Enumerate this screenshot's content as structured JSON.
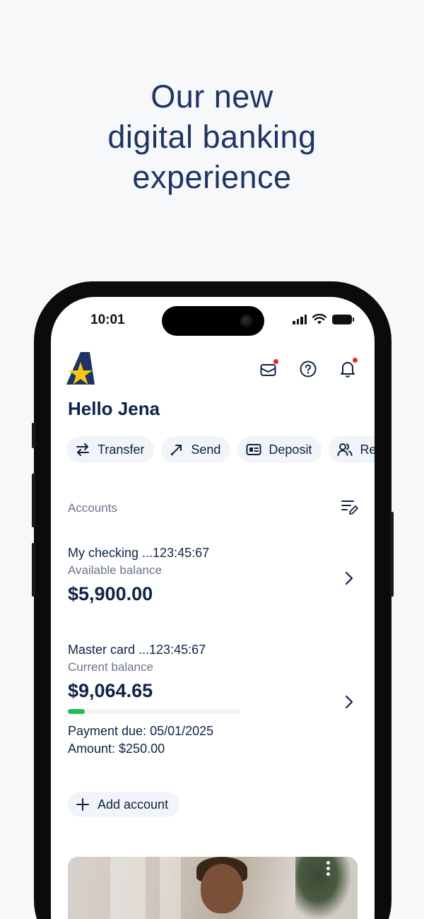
{
  "headline": {
    "line1": "Our new",
    "line2": "digital banking",
    "line3": "experience"
  },
  "status_bar": {
    "time": "10:01"
  },
  "app": {
    "logo_icon": "star-a-logo",
    "header_icons": [
      "mail-icon",
      "help-icon",
      "bell-icon"
    ],
    "greeting": "Hello Jena",
    "quick_actions": [
      {
        "label": "Transfer",
        "icon": "transfer-arrows-icon"
      },
      {
        "label": "Send",
        "icon": "send-arrow-icon"
      },
      {
        "label": "Deposit",
        "icon": "check-deposit-icon"
      },
      {
        "label": "Re",
        "icon": "people-icon"
      }
    ],
    "accounts_title": "Accounts",
    "accounts": [
      {
        "name": "My checking ...123:45:67",
        "balance_label": "Available balance",
        "balance": "$5,900.00"
      },
      {
        "name": "Master card ...123:45:67",
        "balance_label": "Current balance",
        "balance": "$9,064.65",
        "payment_due": "Payment due: 05/01/2025",
        "amount": "Amount: $250.00",
        "progress_fraction": 0.1
      }
    ],
    "add_account_label": "Add account"
  },
  "colors": {
    "navy": "#0f2347",
    "headline": "#1e3563",
    "accent_yellow": "#f5c518",
    "notification_dot": "#e5252f",
    "progress_green": "#1fbe55",
    "muted_text": "#6a7588"
  }
}
